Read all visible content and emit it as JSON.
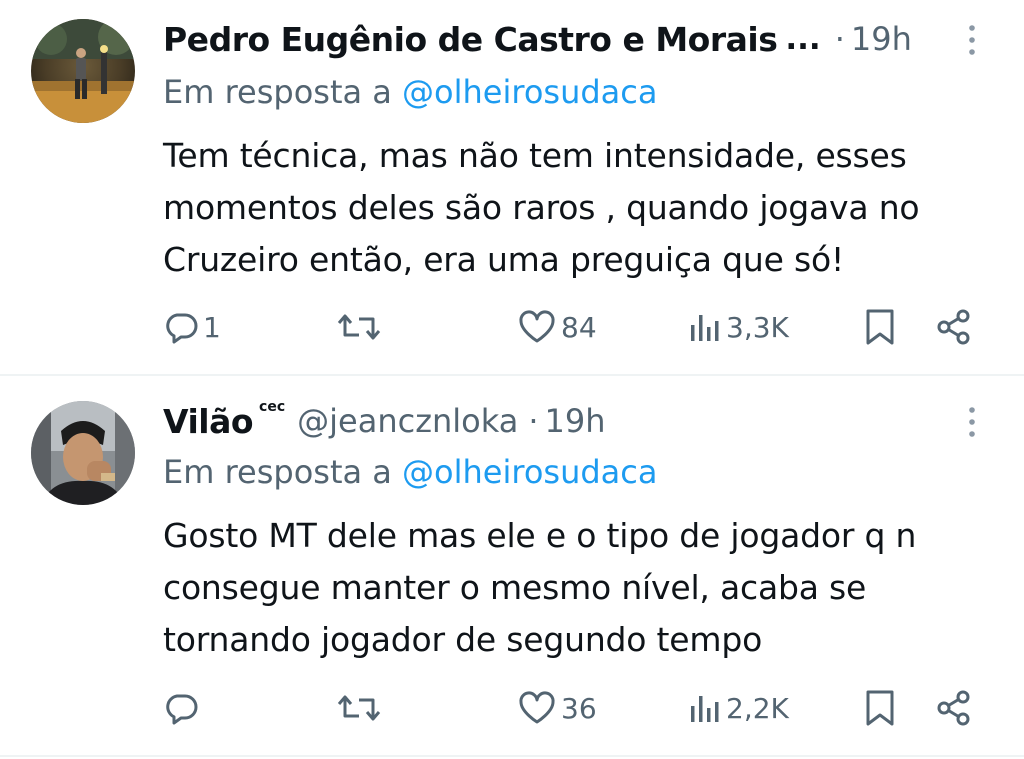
{
  "tweets": [
    {
      "author_name": "Pedro Eugênio de Castro e Morais",
      "name_truncation": "...",
      "time_separator": "·",
      "time": "19h",
      "reply_prefix": "Em resposta a",
      "reply_handle": "@olheirosudaca",
      "text": "Tem técnica, mas não tem intensidade, esses momentos deles são raros , quando jogava no Cruzeiro então, era uma preguiça que só!",
      "replies": "1",
      "retweets": "",
      "likes": "84",
      "views": "3,3K",
      "icons": [
        "reply-icon",
        "retweet-icon",
        "like-icon",
        "views-icon",
        "bookmark-icon",
        "share-icon",
        "more-icon"
      ]
    },
    {
      "author_name": "Vilão",
      "author_badge": "cec",
      "author_handle": "@jeancznloka",
      "time_separator": "·",
      "time": "19h",
      "reply_prefix": "Em resposta a",
      "reply_handle": "@olheirosudaca",
      "text": "Gosto MT dele mas ele e o tipo de jogador q n consegue manter o mesmo nível, acaba se tornando jogador de segundo tempo",
      "replies": "",
      "retweets": "",
      "likes": "36",
      "views": "2,2K",
      "icons": [
        "reply-icon",
        "retweet-icon",
        "like-icon",
        "views-icon",
        "bookmark-icon",
        "share-icon",
        "more-icon"
      ]
    }
  ],
  "colors": {
    "text": "#0f1419",
    "secondary": "#536471",
    "link": "#1d9bf0",
    "divider": "#eff3f4"
  }
}
